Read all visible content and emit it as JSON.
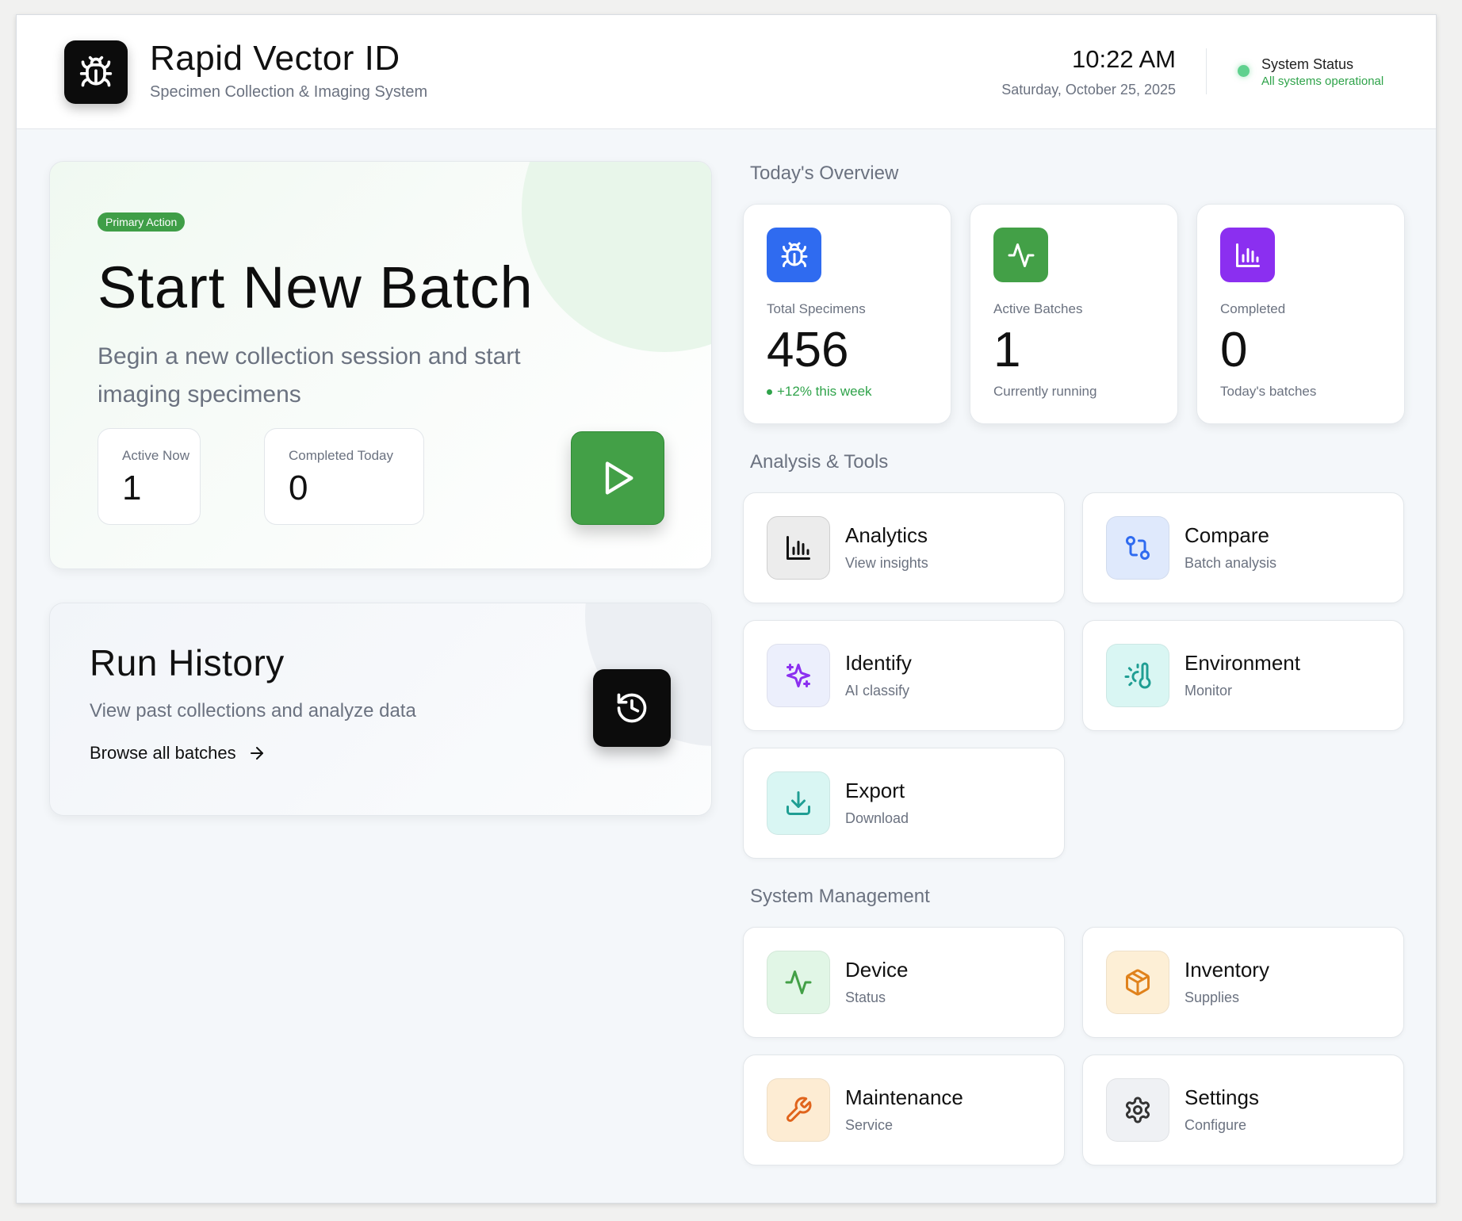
{
  "header": {
    "title": "Rapid Vector ID",
    "subtitle": "Specimen Collection & Imaging System",
    "time": "10:22 AM",
    "date": "Saturday, October 25, 2025",
    "status_label": "System Status",
    "status_text": "All systems operational",
    "logo_icon": "bug-icon"
  },
  "batch": {
    "pill": "Primary Action",
    "title": "Start New Batch",
    "description": "Begin a new collection session and start imaging specimens",
    "active_label": "Active Now",
    "active_value": "1",
    "completed_label": "Completed Today",
    "completed_value": "0",
    "button_icon": "play-icon"
  },
  "history": {
    "title": "Run History",
    "description": "View past collections and analyze data",
    "link": "Browse all batches",
    "button_icon": "history-icon"
  },
  "overview": {
    "title": "Today's Overview",
    "stats": [
      {
        "label": "Total Specimens",
        "value": "456",
        "sub": "+12% this week",
        "icon": "bug-icon",
        "color": "#2f6bf0"
      },
      {
        "label": "Active Batches",
        "value": "1",
        "sub": "Currently running",
        "icon": "activity-icon",
        "color": "#43a047"
      },
      {
        "label": "Completed",
        "value": "0",
        "sub": "Today's batches",
        "icon": "bar-chart-icon",
        "color": "#8b2ff0"
      }
    ]
  },
  "tools": {
    "title": "Analysis & Tools",
    "items": [
      {
        "name": "Analytics",
        "desc": "View insights",
        "icon": "bar-chart-icon"
      },
      {
        "name": "Compare",
        "desc": "Batch analysis",
        "icon": "git-compare-icon"
      },
      {
        "name": "Identify",
        "desc": "AI classify",
        "icon": "sparkles-icon"
      },
      {
        "name": "Environment",
        "desc": "Monitor",
        "icon": "thermometer-sun-icon"
      },
      {
        "name": "Export",
        "desc": "Download",
        "icon": "download-icon"
      }
    ]
  },
  "system": {
    "title": "System Management",
    "items": [
      {
        "name": "Device",
        "desc": "Status",
        "icon": "activity-icon"
      },
      {
        "name": "Inventory",
        "desc": "Supplies",
        "icon": "package-icon"
      },
      {
        "name": "Maintenance",
        "desc": "Service",
        "icon": "wrench-icon"
      },
      {
        "name": "Settings",
        "desc": "Configure",
        "icon": "settings-icon"
      }
    ]
  }
}
